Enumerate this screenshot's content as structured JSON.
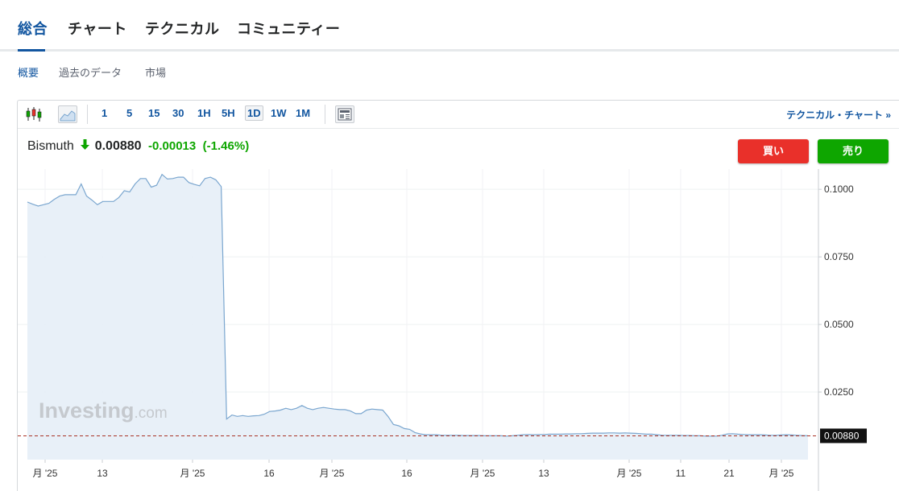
{
  "top_tabs": [
    "総合",
    "チャート",
    "テクニカル",
    "コミュニティー"
  ],
  "sub_tabs": [
    "概要",
    "過去のデータ",
    "市場"
  ],
  "toolbar": {
    "intervals": [
      "1",
      "5",
      "15",
      "30",
      "1H",
      "5H",
      "1D",
      "1W",
      "1M"
    ],
    "active_interval": "1D",
    "technical_link": "テクニカル・チャート »"
  },
  "quote": {
    "name": "Bismuth",
    "price": "0.00880",
    "change": "-0.00013",
    "change_pct": "(-1.46%)"
  },
  "buttons": {
    "buy": "買い",
    "sell": "売り"
  },
  "watermark": {
    "main": "Investing",
    "suffix": ".com"
  },
  "colors": {
    "accent": "#1256a0",
    "buy": "#e9302a",
    "sell": "#0ea600",
    "line": "#7aa6cf",
    "fill": "#e6eef7",
    "price_line": "#a93226"
  },
  "chart_data": {
    "type": "area",
    "x_tick_labels": [
      "月 '25",
      "13",
      "月 '25",
      "16",
      "月 '25",
      "16",
      "月 '25",
      "13",
      "月 '25",
      "11",
      "21",
      "月 '25"
    ],
    "y_tick_labels": [
      "0.1000",
      "0.0750",
      "0.0500",
      "0.0250"
    ],
    "ylim": [
      0,
      0.1075
    ],
    "grid": true,
    "last_price_label": "0.00880",
    "values": [
      0.0953,
      0.0945,
      0.0938,
      0.0943,
      0.0948,
      0.0963,
      0.0975,
      0.098,
      0.098,
      0.098,
      0.102,
      0.0975,
      0.096,
      0.0943,
      0.0955,
      0.0955,
      0.0955,
      0.097,
      0.0995,
      0.099,
      0.102,
      0.104,
      0.104,
      0.1008,
      0.1015,
      0.1055,
      0.1038,
      0.104,
      0.1045,
      0.1045,
      0.1025,
      0.1018,
      0.1013,
      0.104,
      0.1045,
      0.1035,
      0.101,
      0.015,
      0.0165,
      0.016,
      0.0163,
      0.016,
      0.0162,
      0.0163,
      0.0168,
      0.0178,
      0.018,
      0.0183,
      0.019,
      0.0185,
      0.019,
      0.02,
      0.019,
      0.0185,
      0.019,
      0.0193,
      0.019,
      0.0187,
      0.0185,
      0.0185,
      0.018,
      0.017,
      0.017,
      0.0183,
      0.0187,
      0.0185,
      0.0183,
      0.016,
      0.013,
      0.0125,
      0.0115,
      0.0112,
      0.01,
      0.0095,
      0.0092,
      0.0092,
      0.0092,
      0.009,
      0.009,
      0.009,
      0.009,
      0.0089,
      0.0089,
      0.0089,
      0.0089,
      0.0088,
      0.0088,
      0.0088,
      0.0088,
      0.0087,
      0.0088,
      0.009,
      0.0092,
      0.0093,
      0.0092,
      0.0093,
      0.0093,
      0.0094,
      0.0094,
      0.0094,
      0.0095,
      0.0095,
      0.0096,
      0.0096,
      0.0097,
      0.0098,
      0.0098,
      0.0098,
      0.0099,
      0.0099,
      0.0098,
      0.0099,
      0.0098,
      0.0097,
      0.0096,
      0.0094,
      0.0094,
      0.0092,
      0.009,
      0.009,
      0.009,
      0.009,
      0.0089,
      0.0089,
      0.0088,
      0.0088,
      0.0087,
      0.0087,
      0.0087,
      0.009,
      0.0095,
      0.0096,
      0.0094,
      0.0093,
      0.0092,
      0.0092,
      0.0092,
      0.0091,
      0.009,
      0.009,
      0.0091,
      0.0092,
      0.0091,
      0.009,
      0.0089,
      0.0088
    ]
  }
}
